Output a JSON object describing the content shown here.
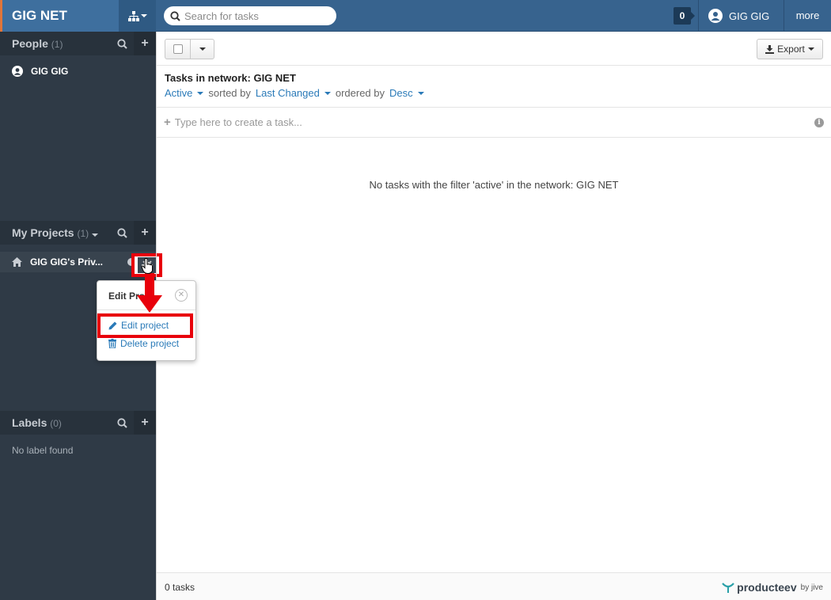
{
  "topbar": {
    "network_name": "GIG NET",
    "search_placeholder": "Search for tasks",
    "notification_count": "0",
    "user_name": "GIG GIG",
    "more_label": "more"
  },
  "sidebar": {
    "people": {
      "title": "People",
      "count": "(1)",
      "items": [
        {
          "name": "GIG GIG"
        }
      ]
    },
    "projects": {
      "title": "My Projects",
      "count": "(1)",
      "items": [
        {
          "name": "GIG GIG's Priv..."
        }
      ]
    },
    "labels": {
      "title": "Labels",
      "count": "(0)",
      "empty_text": "No label found"
    }
  },
  "popover": {
    "title": "Edit Pro",
    "edit_label": "Edit project",
    "delete_label": "Delete project"
  },
  "toolbar": {
    "export_label": "Export"
  },
  "list": {
    "title": "Tasks in network: GIG NET",
    "filter": "Active",
    "sorted_by_label": "sorted by",
    "sort": "Last Changed",
    "ordered_by_label": "ordered by",
    "order": "Desc",
    "create_placeholder": "Type here to create a task...",
    "empty_message": "No tasks with the filter 'active' in the network: GIG NET"
  },
  "footer": {
    "task_count": "0 tasks",
    "brand": "producteev",
    "brand_suffix": "by jive"
  },
  "colors": {
    "topbar": "#37638e",
    "sidebar": "#2f3a46",
    "link": "#2a7ab8",
    "highlight": "#e8000b"
  }
}
